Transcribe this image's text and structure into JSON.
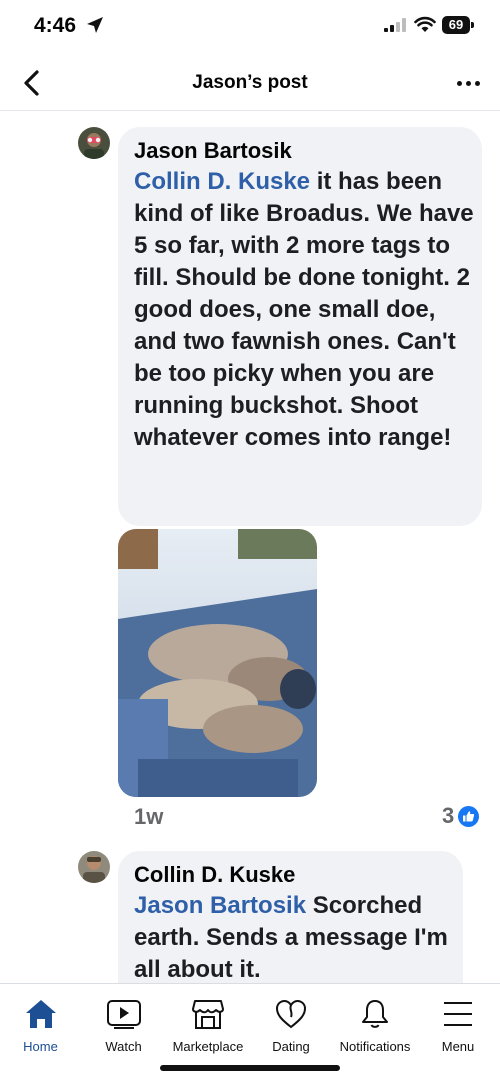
{
  "status": {
    "time": "4:46",
    "battery": "69"
  },
  "header": {
    "title": "Jason’s post"
  },
  "comments": [
    {
      "author": "Jason Bartosik",
      "mention": "Collin D. Kuske",
      "text": " it has been kind of like Broadus. We have 5 so far, with 2 more tags to fill. Should be done tonight. 2 good does, one small doe, and two fawnish ones. Can't be too picky when you are running buckshot. Shoot whatever comes into range!",
      "time": "1w",
      "reaction_count": "3"
    },
    {
      "author": "Collin D. Kuske",
      "mention": "Jason Bartosik",
      "text": " Scorched earth. Sends a message I'm all about it."
    }
  ],
  "tabs": [
    {
      "label": "Home",
      "icon": "home-icon",
      "active": true
    },
    {
      "label": "Watch",
      "icon": "watch-icon"
    },
    {
      "label": "Marketplace",
      "icon": "marketplace-icon"
    },
    {
      "label": "Dating",
      "icon": "dating-icon"
    },
    {
      "label": "Notifications",
      "icon": "bell-icon"
    },
    {
      "label": "Menu",
      "icon": "menu-icon"
    }
  ],
  "colors": {
    "accent": "#1c4f94",
    "mention": "#2e5fa8",
    "bubble": "#f0f2f5",
    "like": "#1877f2"
  }
}
